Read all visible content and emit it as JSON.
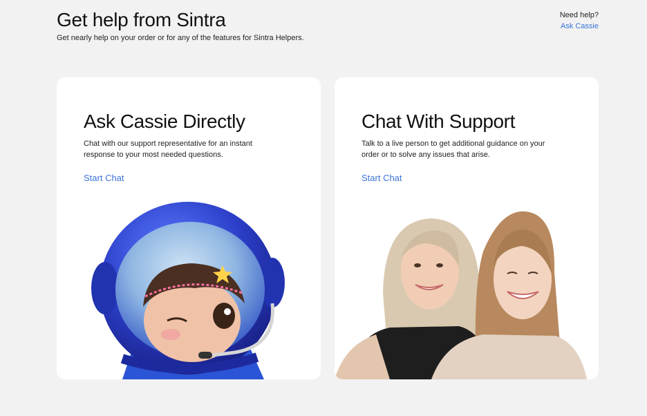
{
  "header": {
    "title": "Get help from Sintra",
    "subtitle": "Get nearly help on your order or for any of the features for Sintra Helpers."
  },
  "help": {
    "question": "Need help?",
    "link": "Ask Cassie"
  },
  "cards": [
    {
      "title": "Ask Cassie Directly",
      "description": "Chat with our support representative for an instant response to your most needed questions.",
      "cta": "Start Chat"
    },
    {
      "title": "Chat With Support",
      "description": "Talk to a live person to get additional guidance on your order or to solve any issues that arise.",
      "cta": "Start Chat"
    }
  ],
  "colors": {
    "background": "#f2f2f2",
    "card": "#ffffff",
    "link": "#3b74d9",
    "helmet": "#2c3fc4"
  }
}
